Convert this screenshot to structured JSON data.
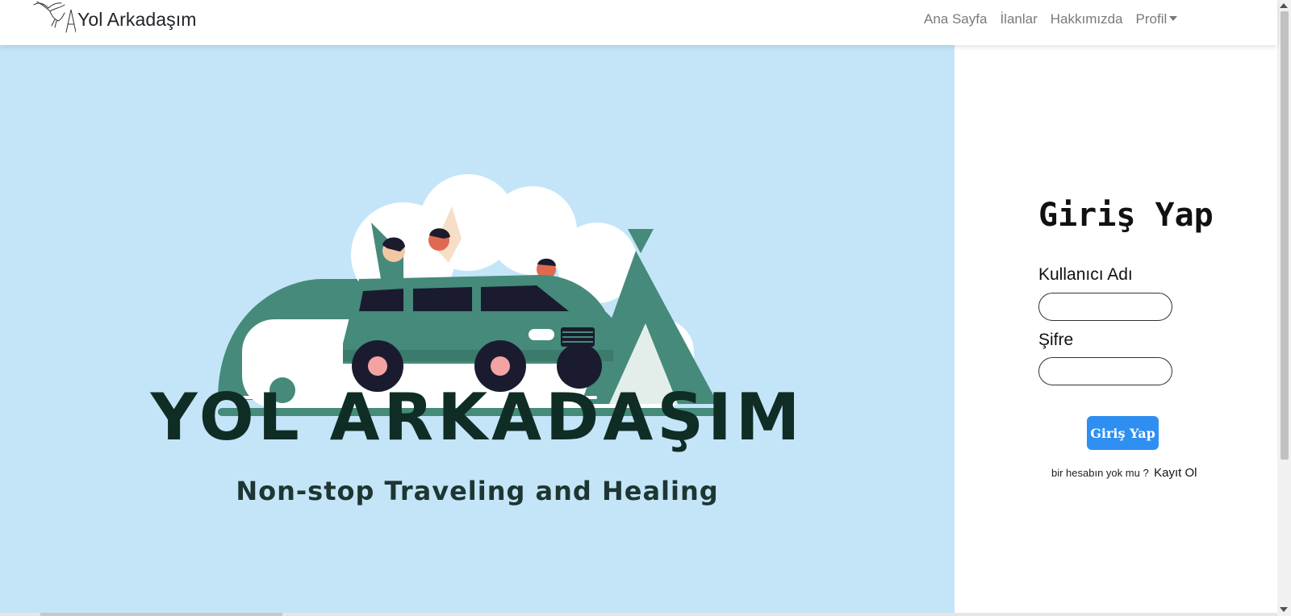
{
  "navbar": {
    "brand_text": "Yol Arkadaşım",
    "links": {
      "home": "Ana Sayfa",
      "listings": "İlanlar",
      "about": "Hakkımızda",
      "profile": "Profil"
    }
  },
  "hero": {
    "title": "YOL ARKADAŞIM",
    "subtitle": "Non-stop Traveling and Healing",
    "background_color": "#c4e5f8",
    "accent_color": "#458a7a"
  },
  "login": {
    "title": "Giriş Yap",
    "username_label": "Kullanıcı Adı",
    "username_value": "",
    "password_label": "Şifre",
    "password_value": "",
    "submit_label": "Giriş Yap",
    "submit_color": "#2f8ff0",
    "signup_prompt": "bir hesabın yok mu ?",
    "signup_link": "Kayıt Ol"
  },
  "icons": {
    "brand_logo": "bird-logo-icon",
    "profile_caret": "caret-down-icon"
  }
}
